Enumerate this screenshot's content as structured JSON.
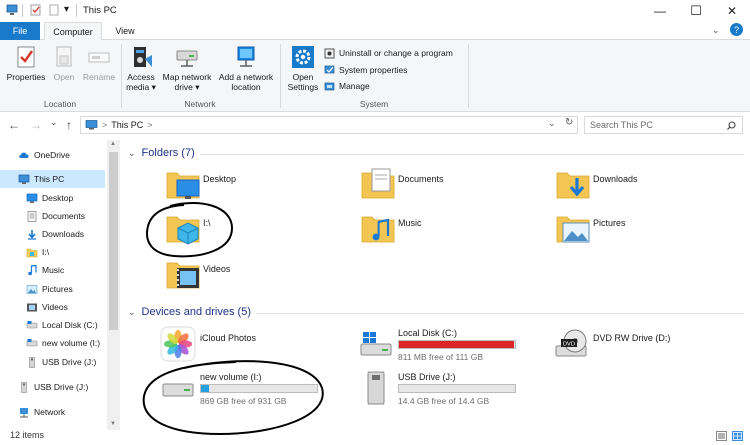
{
  "window": {
    "title": "This PC",
    "qat_dropdown": "▾",
    "minimize": "—",
    "maximize": "☐",
    "close": "✕",
    "help": "?"
  },
  "ribbon": {
    "tabs": [
      "File",
      "Computer",
      "View"
    ],
    "location_group": {
      "label": "Location",
      "buttons": [
        "Properties",
        "Open",
        "Rename"
      ]
    },
    "network_group": {
      "label": "Network",
      "access_media": [
        "Access",
        "media ▾"
      ],
      "map_drive": [
        "Map network",
        "drive ▾"
      ],
      "add_location": [
        "Add a network",
        "location"
      ]
    },
    "system_group": {
      "label": "System",
      "open_settings": [
        "Open",
        "Settings"
      ],
      "uninstall": "Uninstall or change a program",
      "system_properties": "System properties",
      "manage": "Manage"
    }
  },
  "address": {
    "back": "←",
    "forward": "→",
    "recent": "⌄",
    "up": "↑",
    "breadcrumb": [
      "This PC",
      ">"
    ],
    "dropdown": "⌄",
    "refresh": "↻",
    "search_placeholder": "Search This PC",
    "search_icon": "search-icon"
  },
  "nav": {
    "items": [
      {
        "label": "OneDrive",
        "icon": "cloud-icon",
        "selected": false
      },
      {
        "label": "This PC",
        "icon": "computer-icon",
        "selected": true
      },
      {
        "label": "Desktop",
        "icon": "desktop-icon",
        "selected": false
      },
      {
        "label": "Documents",
        "icon": "documents-icon",
        "selected": false
      },
      {
        "label": "Downloads",
        "icon": "downloads-icon",
        "selected": false
      },
      {
        "label": "I:\\",
        "icon": "folder-icon",
        "selected": false
      },
      {
        "label": "Music",
        "icon": "music-icon",
        "selected": false
      },
      {
        "label": "Pictures",
        "icon": "pictures-icon",
        "selected": false
      },
      {
        "label": "Videos",
        "icon": "videos-icon",
        "selected": false
      },
      {
        "label": "Local Disk (C:)",
        "icon": "drive-icon",
        "selected": false
      },
      {
        "label": "new volume  (I:)",
        "icon": "drive-icon",
        "selected": false
      },
      {
        "label": "USB Drive (J:)",
        "icon": "usb-icon",
        "selected": false
      },
      {
        "label": "USB Drive (J:)",
        "icon": "usb-icon",
        "selected": false
      },
      {
        "label": "Network",
        "icon": "network-icon",
        "selected": false
      }
    ]
  },
  "folders": {
    "heading": "Folders (7)",
    "items": [
      {
        "label": "Desktop",
        "icon": "desktop-folder-icon"
      },
      {
        "label": "Documents",
        "icon": "documents-folder-icon"
      },
      {
        "label": "Downloads",
        "icon": "downloads-folder-icon"
      },
      {
        "label": "I:\\",
        "icon": "folder-3d-icon"
      },
      {
        "label": "Music",
        "icon": "music-folder-icon"
      },
      {
        "label": "Pictures",
        "icon": "pictures-folder-icon"
      },
      {
        "label": "Videos",
        "icon": "videos-folder-icon"
      }
    ]
  },
  "drives": {
    "heading": "Devices and drives (5)",
    "items": [
      {
        "name": "iCloud Photos",
        "icon": "icloud-photos-icon",
        "free": "",
        "used_fraction": null,
        "bar_color": ""
      },
      {
        "name": "Local Disk (C:)",
        "icon": "windows-drive-icon",
        "free": "811 MB free of 111 GB",
        "used_fraction": 0.993,
        "bar_color": "#da2626"
      },
      {
        "name": "DVD RW Drive (D:)",
        "icon": "dvd-drive-icon",
        "free": "",
        "used_fraction": null,
        "bar_color": ""
      },
      {
        "name": "new volume  (I:)",
        "icon": "hard-drive-icon",
        "free": "869 GB free of 931 GB",
        "used_fraction": 0.067,
        "bar_color": "#26a0da"
      },
      {
        "name": "USB Drive (J:)",
        "icon": "usb-drive-icon",
        "free": "14.4 GB free of 14.4 GB",
        "used_fraction": 0.0,
        "bar_color": "#26a0da"
      }
    ]
  },
  "status": {
    "item_count": "12 items"
  },
  "colors": {
    "accent": "#1979ca",
    "selected_bg": "#cce8ff",
    "heading": "#1e3287",
    "drive_full": "#da2626",
    "drive_normal": "#26a0da"
  }
}
